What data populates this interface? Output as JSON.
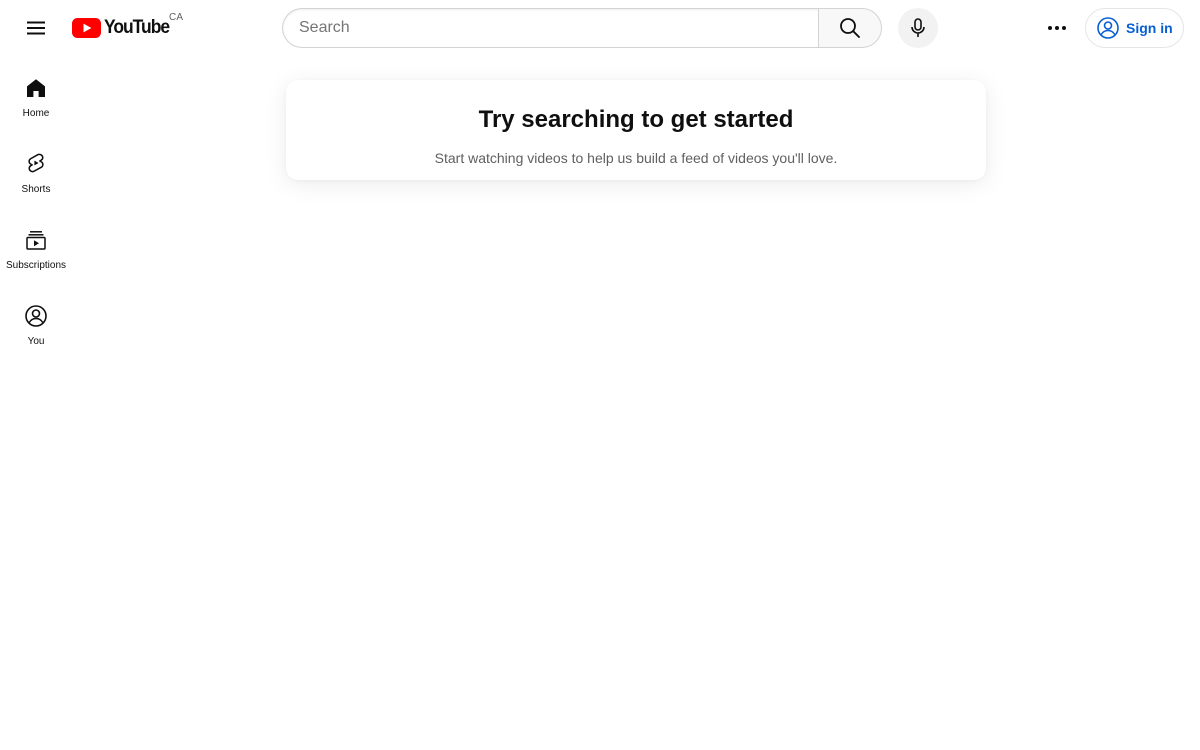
{
  "masthead": {
    "logo_text": "YouTube",
    "country_code": "CA",
    "search": {
      "placeholder": "Search",
      "value": ""
    },
    "sign_in_label": "Sign in",
    "icons": {
      "menu": "hamburger-menu-icon",
      "search": "search-icon",
      "mic": "microphone-icon",
      "more": "more-horizontal-icon",
      "account": "account-circle-icon"
    }
  },
  "guide": {
    "items": [
      {
        "label": "Home",
        "icon": "home-icon"
      },
      {
        "label": "Shorts",
        "icon": "shorts-icon"
      },
      {
        "label": "Subscriptions",
        "icon": "subscriptions-icon"
      },
      {
        "label": "You",
        "icon": "you-icon"
      }
    ]
  },
  "prompt": {
    "title": "Try searching to get started",
    "subtitle": "Start watching videos to help us build a feed of videos you'll love."
  },
  "colors": {
    "brand_red": "#ff0000",
    "link_blue": "#065fd4",
    "text_primary": "#0f0f0f",
    "text_secondary": "#606060"
  }
}
